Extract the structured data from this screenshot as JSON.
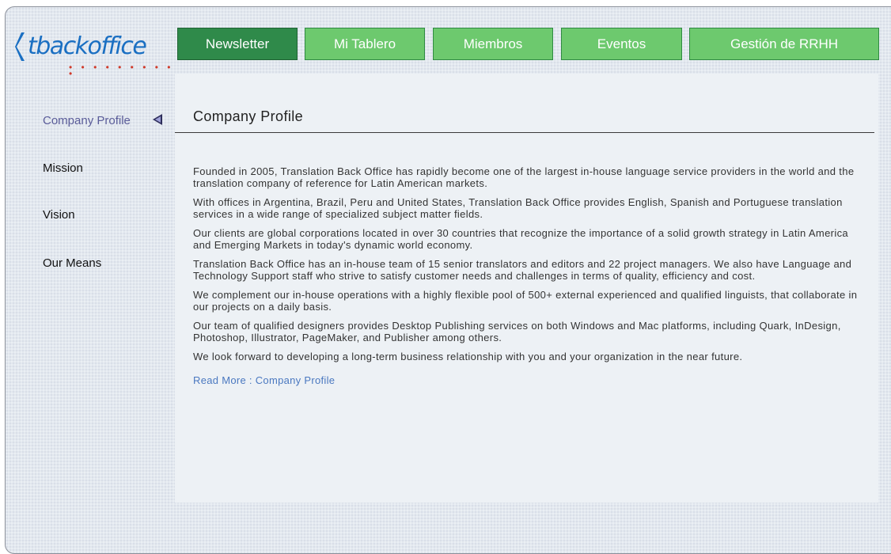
{
  "logo": {
    "text": "tbackoffice",
    "dots": "• • • • • • • • • •"
  },
  "nav": {
    "tabs": [
      {
        "label": "Newsletter",
        "active": true
      },
      {
        "label": "Mi Tablero",
        "active": false
      },
      {
        "label": "Miembros",
        "active": false
      },
      {
        "label": "Eventos",
        "active": false
      },
      {
        "label": "Gestión de RRHH",
        "active": false
      }
    ]
  },
  "sidebar": {
    "items": [
      {
        "label": "Company Profile",
        "active": true
      },
      {
        "label": "Mission",
        "active": false
      },
      {
        "label": "Vision",
        "active": false
      },
      {
        "label": "Our Means",
        "active": false
      }
    ]
  },
  "main": {
    "title": "Company Profile",
    "paragraphs": [
      "Founded in 2005, Translation Back Office has rapidly become one of the largest in-house language service providers in the world and the translation company of reference for Latin American markets.",
      "With offices in Argentina, Brazil, Peru and United States, Translation Back Office provides English, Spanish and Portuguese translation services in a wide range of specialized subject matter fields.",
      "Our clients are global corporations located in over 30 countries that recognize the importance of a solid growth strategy in Latin America and Emerging Markets in today's dynamic world economy.",
      "Translation Back Office has an in-house team of 15 senior translators and editors and 22 project managers. We also have Language and Technology Support staff who strive to satisfy customer needs and challenges in terms of quality, efficiency and cost.",
      "We complement our in-house operations with a highly flexible pool of 500+ external experienced and qualified linguists, that collaborate in our projects on a daily basis.",
      "Our team of qualified designers provides Desktop Publishing services on both Windows and Mac platforms, including Quark, InDesign, Photoshop, Illustrator, PageMaker, and Publisher among others.",
      "We look forward to developing a long-term business relationship with you and your organization in the near future."
    ],
    "read_more": "Read More : Company Profile"
  },
  "colors": {
    "tab": "#6dc96e",
    "tab_active": "#2f8a4a",
    "link": "#4a78c0",
    "logo": "#1a6fc2",
    "logo_dots": "#d03a2a"
  }
}
